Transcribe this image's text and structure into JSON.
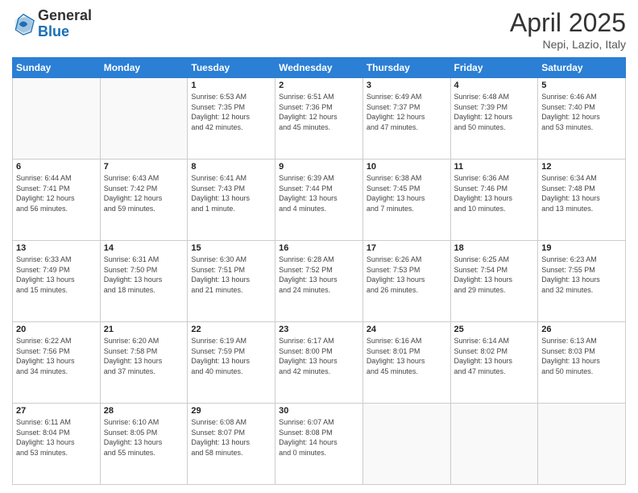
{
  "header": {
    "logo_general": "General",
    "logo_blue": "Blue",
    "title": "April 2025",
    "subtitle": "Nepi, Lazio, Italy"
  },
  "weekdays": [
    "Sunday",
    "Monday",
    "Tuesday",
    "Wednesday",
    "Thursday",
    "Friday",
    "Saturday"
  ],
  "weeks": [
    [
      {
        "day": "",
        "detail": ""
      },
      {
        "day": "",
        "detail": ""
      },
      {
        "day": "1",
        "detail": "Sunrise: 6:53 AM\nSunset: 7:35 PM\nDaylight: 12 hours\nand 42 minutes."
      },
      {
        "day": "2",
        "detail": "Sunrise: 6:51 AM\nSunset: 7:36 PM\nDaylight: 12 hours\nand 45 minutes."
      },
      {
        "day": "3",
        "detail": "Sunrise: 6:49 AM\nSunset: 7:37 PM\nDaylight: 12 hours\nand 47 minutes."
      },
      {
        "day": "4",
        "detail": "Sunrise: 6:48 AM\nSunset: 7:39 PM\nDaylight: 12 hours\nand 50 minutes."
      },
      {
        "day": "5",
        "detail": "Sunrise: 6:46 AM\nSunset: 7:40 PM\nDaylight: 12 hours\nand 53 minutes."
      }
    ],
    [
      {
        "day": "6",
        "detail": "Sunrise: 6:44 AM\nSunset: 7:41 PM\nDaylight: 12 hours\nand 56 minutes."
      },
      {
        "day": "7",
        "detail": "Sunrise: 6:43 AM\nSunset: 7:42 PM\nDaylight: 12 hours\nand 59 minutes."
      },
      {
        "day": "8",
        "detail": "Sunrise: 6:41 AM\nSunset: 7:43 PM\nDaylight: 13 hours\nand 1 minute."
      },
      {
        "day": "9",
        "detail": "Sunrise: 6:39 AM\nSunset: 7:44 PM\nDaylight: 13 hours\nand 4 minutes."
      },
      {
        "day": "10",
        "detail": "Sunrise: 6:38 AM\nSunset: 7:45 PM\nDaylight: 13 hours\nand 7 minutes."
      },
      {
        "day": "11",
        "detail": "Sunrise: 6:36 AM\nSunset: 7:46 PM\nDaylight: 13 hours\nand 10 minutes."
      },
      {
        "day": "12",
        "detail": "Sunrise: 6:34 AM\nSunset: 7:48 PM\nDaylight: 13 hours\nand 13 minutes."
      }
    ],
    [
      {
        "day": "13",
        "detail": "Sunrise: 6:33 AM\nSunset: 7:49 PM\nDaylight: 13 hours\nand 15 minutes."
      },
      {
        "day": "14",
        "detail": "Sunrise: 6:31 AM\nSunset: 7:50 PM\nDaylight: 13 hours\nand 18 minutes."
      },
      {
        "day": "15",
        "detail": "Sunrise: 6:30 AM\nSunset: 7:51 PM\nDaylight: 13 hours\nand 21 minutes."
      },
      {
        "day": "16",
        "detail": "Sunrise: 6:28 AM\nSunset: 7:52 PM\nDaylight: 13 hours\nand 24 minutes."
      },
      {
        "day": "17",
        "detail": "Sunrise: 6:26 AM\nSunset: 7:53 PM\nDaylight: 13 hours\nand 26 minutes."
      },
      {
        "day": "18",
        "detail": "Sunrise: 6:25 AM\nSunset: 7:54 PM\nDaylight: 13 hours\nand 29 minutes."
      },
      {
        "day": "19",
        "detail": "Sunrise: 6:23 AM\nSunset: 7:55 PM\nDaylight: 13 hours\nand 32 minutes."
      }
    ],
    [
      {
        "day": "20",
        "detail": "Sunrise: 6:22 AM\nSunset: 7:56 PM\nDaylight: 13 hours\nand 34 minutes."
      },
      {
        "day": "21",
        "detail": "Sunrise: 6:20 AM\nSunset: 7:58 PM\nDaylight: 13 hours\nand 37 minutes."
      },
      {
        "day": "22",
        "detail": "Sunrise: 6:19 AM\nSunset: 7:59 PM\nDaylight: 13 hours\nand 40 minutes."
      },
      {
        "day": "23",
        "detail": "Sunrise: 6:17 AM\nSunset: 8:00 PM\nDaylight: 13 hours\nand 42 minutes."
      },
      {
        "day": "24",
        "detail": "Sunrise: 6:16 AM\nSunset: 8:01 PM\nDaylight: 13 hours\nand 45 minutes."
      },
      {
        "day": "25",
        "detail": "Sunrise: 6:14 AM\nSunset: 8:02 PM\nDaylight: 13 hours\nand 47 minutes."
      },
      {
        "day": "26",
        "detail": "Sunrise: 6:13 AM\nSunset: 8:03 PM\nDaylight: 13 hours\nand 50 minutes."
      }
    ],
    [
      {
        "day": "27",
        "detail": "Sunrise: 6:11 AM\nSunset: 8:04 PM\nDaylight: 13 hours\nand 53 minutes."
      },
      {
        "day": "28",
        "detail": "Sunrise: 6:10 AM\nSunset: 8:05 PM\nDaylight: 13 hours\nand 55 minutes."
      },
      {
        "day": "29",
        "detail": "Sunrise: 6:08 AM\nSunset: 8:07 PM\nDaylight: 13 hours\nand 58 minutes."
      },
      {
        "day": "30",
        "detail": "Sunrise: 6:07 AM\nSunset: 8:08 PM\nDaylight: 14 hours\nand 0 minutes."
      },
      {
        "day": "",
        "detail": ""
      },
      {
        "day": "",
        "detail": ""
      },
      {
        "day": "",
        "detail": ""
      }
    ]
  ]
}
